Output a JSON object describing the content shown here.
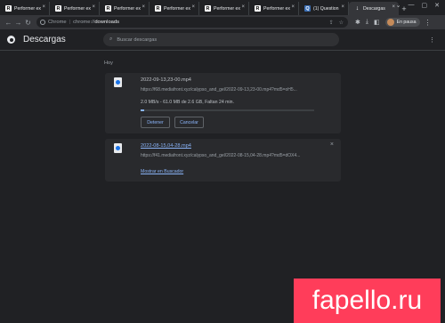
{
  "tabs": [
    {
      "label": "Performer ex",
      "icon": "R"
    },
    {
      "label": "Performer ex",
      "icon": "R"
    },
    {
      "label": "Performer ex",
      "icon": "R"
    },
    {
      "label": "Performer ex",
      "icon": "R"
    },
    {
      "label": "Performer ex",
      "icon": "R"
    },
    {
      "label": "Performer ex",
      "icon": "R"
    },
    {
      "label": "(1) Question",
      "icon": "Q"
    },
    {
      "label": "Descargas",
      "icon": "↓",
      "active": true
    }
  ],
  "toolbar": {
    "site_label": "Chrome",
    "url_scheme": "chrome://",
    "url_path": "downloads",
    "profile_status": "En pausa"
  },
  "header": {
    "title": "Descargas",
    "search_placeholder": "Buscar descargas"
  },
  "downloads": {
    "day_label": "Hoy",
    "items": [
      {
        "filename": "2022-09-13,23-00.mp4",
        "url": "https://f68.mediafront.xyz/calypso_and_gel/2022-09-13,23-00.mp4?md5=oH5...",
        "status": "2.0 MB/s - 61.0 MB de 2.6 GB, Faltan 24 min.",
        "progress_percent": 2.3,
        "actions": [
          "Detener",
          "Cancelar"
        ]
      },
      {
        "filename": "2022-08-15,04-28.mp4",
        "url": "https://f41.mediafront.xyz/calypso_and_gel/2022-08-15,04-28.mp4?md5=dOX4...",
        "action_link": "Mostrar en Buscador",
        "close_icon": "×"
      }
    ]
  },
  "watermark": {
    "text": "fapello.ru",
    "color": "#ff3d5a"
  }
}
